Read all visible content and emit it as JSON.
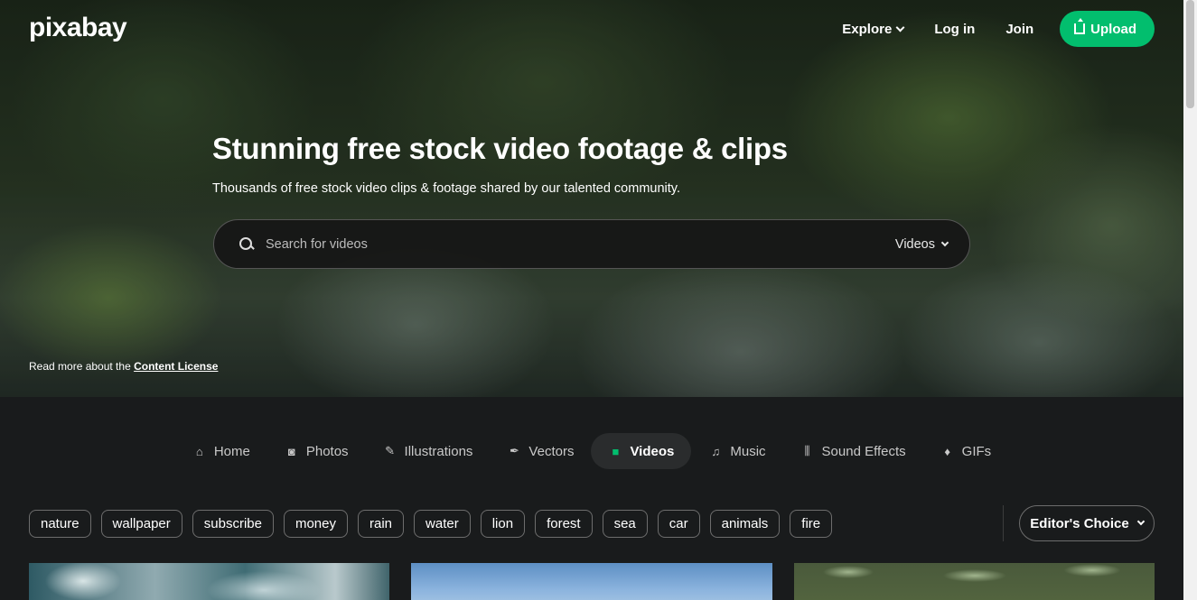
{
  "header": {
    "logo": "pixabay",
    "nav": [
      {
        "label": "Explore"
      },
      {
        "label": "Log in"
      },
      {
        "label": "Join"
      }
    ],
    "upload_label": "Upload"
  },
  "hero": {
    "title": "Stunning free stock video footage & clips",
    "subtitle": "Thousands of free stock video clips & footage shared by our talented community.",
    "search": {
      "placeholder": "Search for videos",
      "type_label": "Videos"
    },
    "license_prefix": "Read more about the ",
    "license_link": "Content License"
  },
  "tabs": [
    {
      "label": "Home",
      "icon": "home-icon"
    },
    {
      "label": "Photos",
      "icon": "camera-icon"
    },
    {
      "label": "Illustrations",
      "icon": "brush-icon"
    },
    {
      "label": "Vectors",
      "icon": "pen-nib-icon"
    },
    {
      "label": "Videos",
      "icon": "video-camera-icon",
      "active": true
    },
    {
      "label": "Music",
      "icon": "music-note-icon"
    },
    {
      "label": "Sound Effects",
      "icon": "waveform-icon"
    },
    {
      "label": "GIFs",
      "icon": "flame-icon"
    }
  ],
  "tags": [
    "nature",
    "wallpaper",
    "subscribe",
    "money",
    "rain",
    "water",
    "lion",
    "forest",
    "sea",
    "car",
    "animals",
    "fire"
  ],
  "sort": {
    "label": "Editor's Choice"
  },
  "colors": {
    "accent": "#02be6e",
    "background": "#191b1c"
  }
}
